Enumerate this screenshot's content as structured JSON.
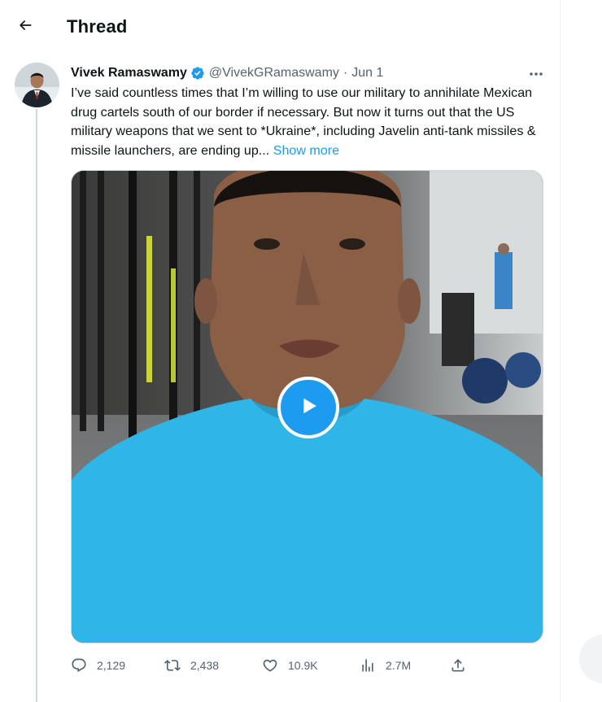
{
  "header": {
    "title": "Thread",
    "back_icon": "arrow-left-icon"
  },
  "tweet": {
    "author": {
      "display_name": "Vivek Ramaswamy",
      "handle": "@VivekGRamaswamy",
      "verified": true,
      "verified_color": "#1d9bf0"
    },
    "date_separator": "·",
    "date": "Jun 1",
    "text": "I’ve said countless times that I’m willing to use our military to annihilate Mexican drug cartels south of our border if necessary. But now it turns out that the US military weapons that we sent to *Ukraine*, including Javelin anti-tank missiles & missile launchers, are ending up... ",
    "show_more_label": "Show more",
    "media": {
      "type": "video",
      "play_icon": "play-icon"
    },
    "actions": {
      "reply_count": "2,129",
      "retweet_count": "2,438",
      "like_count": "10.9K",
      "view_count": "2.7M"
    }
  },
  "colors": {
    "accent": "#1d9bf0",
    "secondary_text": "#536471",
    "thread_line": "#cfd9de"
  }
}
